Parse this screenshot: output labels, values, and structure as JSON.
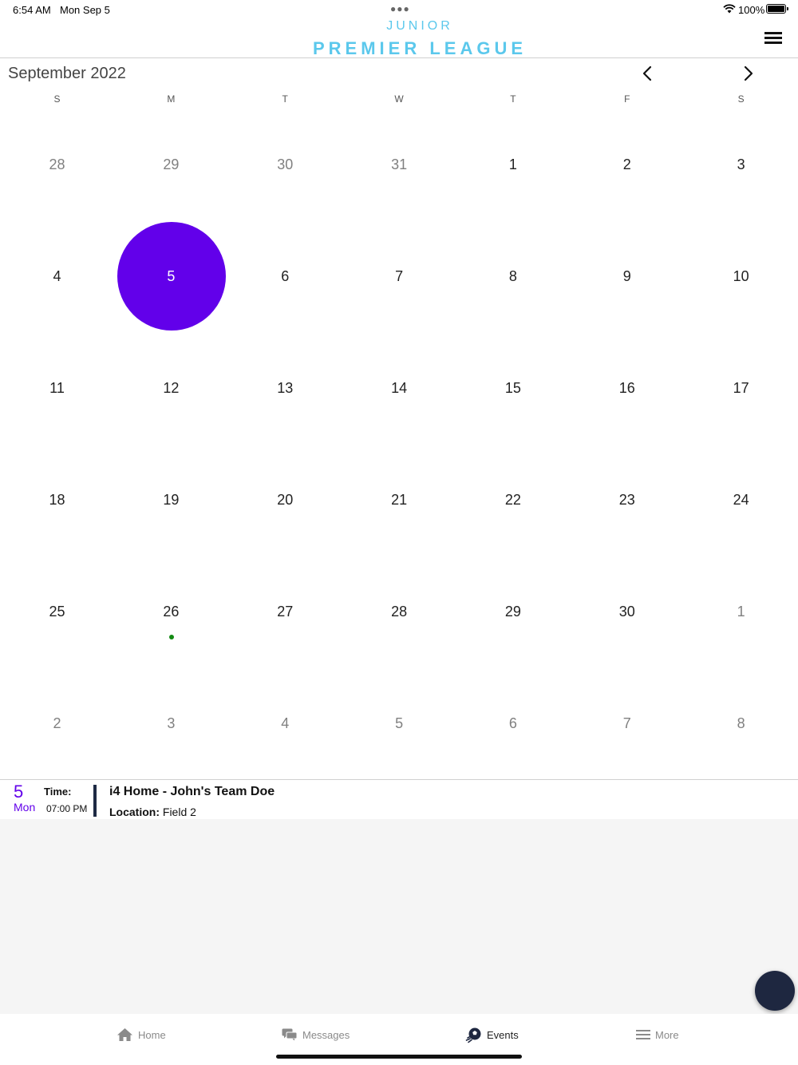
{
  "status_bar": {
    "time": "6:54 AM",
    "date": "Mon Sep 5",
    "battery": "100%"
  },
  "header": {
    "logo_top": "JUNIOR",
    "logo_bottom": "PREMIER LEAGUE",
    "brand_color": "#5bc8ec"
  },
  "calendar": {
    "month_title": "September 2022",
    "weekdays": [
      "S",
      "M",
      "T",
      "W",
      "T",
      "F",
      "S"
    ],
    "selected_color": "#6200ea",
    "event_dot_color": "#138a13",
    "weeks": [
      [
        {
          "d": "28",
          "other": true
        },
        {
          "d": "29",
          "other": true
        },
        {
          "d": "30",
          "other": true
        },
        {
          "d": "31",
          "other": true
        },
        {
          "d": "1"
        },
        {
          "d": "2"
        },
        {
          "d": "3"
        }
      ],
      [
        {
          "d": "4"
        },
        {
          "d": "5",
          "selected": true
        },
        {
          "d": "6"
        },
        {
          "d": "7"
        },
        {
          "d": "8"
        },
        {
          "d": "9"
        },
        {
          "d": "10"
        }
      ],
      [
        {
          "d": "11"
        },
        {
          "d": "12"
        },
        {
          "d": "13"
        },
        {
          "d": "14"
        },
        {
          "d": "15"
        },
        {
          "d": "16"
        },
        {
          "d": "17"
        }
      ],
      [
        {
          "d": "18"
        },
        {
          "d": "19"
        },
        {
          "d": "20"
        },
        {
          "d": "21"
        },
        {
          "d": "22"
        },
        {
          "d": "23"
        },
        {
          "d": "24"
        }
      ],
      [
        {
          "d": "25"
        },
        {
          "d": "26",
          "event": true
        },
        {
          "d": "27"
        },
        {
          "d": "28"
        },
        {
          "d": "29"
        },
        {
          "d": "30"
        },
        {
          "d": "1",
          "other": true
        }
      ],
      [
        {
          "d": "2",
          "other": true
        },
        {
          "d": "3",
          "other": true
        },
        {
          "d": "4",
          "other": true
        },
        {
          "d": "5",
          "other": true
        },
        {
          "d": "6",
          "other": true
        },
        {
          "d": "7",
          "other": true
        },
        {
          "d": "8",
          "other": true
        }
      ]
    ]
  },
  "event": {
    "day_num": "5",
    "day_name": "Mon",
    "time_label": "Time:",
    "time_value": "07:00 PM",
    "title": "i4 Home - John's Team Doe",
    "location_label": "Location:",
    "location_value": "Field 2"
  },
  "tabs": [
    {
      "label": "Home",
      "icon": "home-icon",
      "active": false
    },
    {
      "label": "Messages",
      "icon": "messages-icon",
      "active": false
    },
    {
      "label": "Events",
      "icon": "soccer-ball-icon",
      "active": true
    },
    {
      "label": "More",
      "icon": "menu-lines-icon",
      "active": false
    }
  ]
}
